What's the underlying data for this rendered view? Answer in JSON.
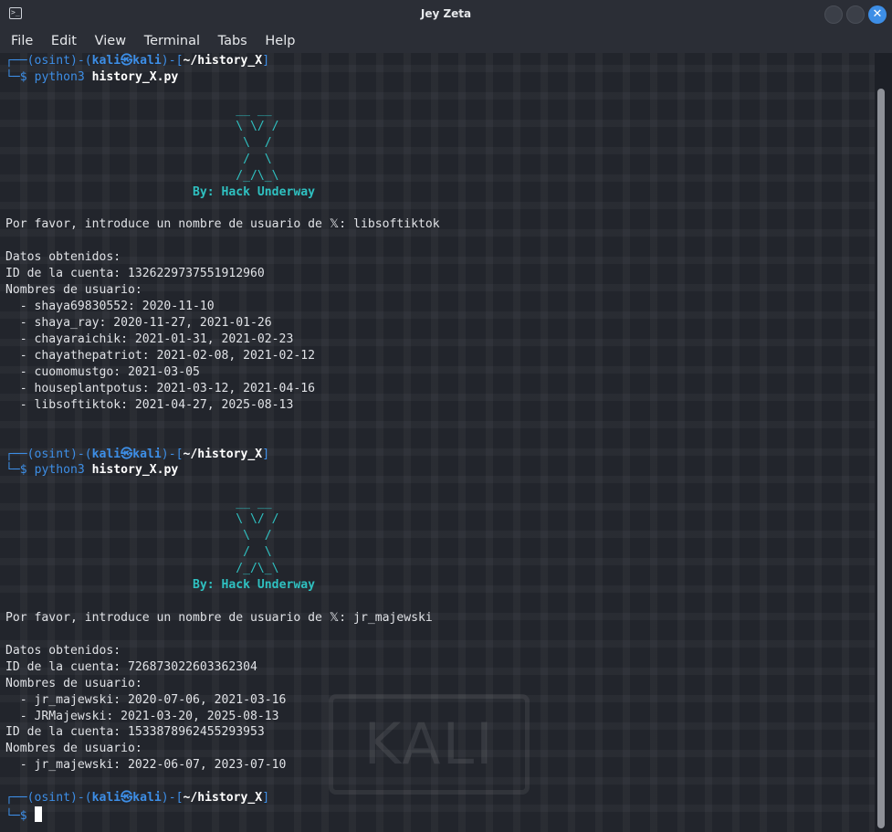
{
  "window": {
    "title": "Jey Zeta",
    "app_icon": "terminal-icon",
    "controls": [
      "minimize-icon",
      "maximize-icon",
      "close-icon"
    ],
    "close_glyph": "✕"
  },
  "menu": [
    "File",
    "Edit",
    "View",
    "Terminal",
    "Tabs",
    "Help"
  ],
  "prompt": {
    "corner_top": "┌──",
    "env": "(osint)",
    "dash": "-",
    "open": "(",
    "user": "kali㉿kali",
    "close": ")",
    "path_open": "-[",
    "path": "~/history_X",
    "path_close": "]",
    "corner_bottom": "└─",
    "symbol": "$ "
  },
  "command": {
    "name": "python3",
    "arg": "history_X.py"
  },
  "banner": {
    "art": [
      "__ __",
      "\\ \\/ /",
      " \\  /",
      " /  \\",
      "/_/\\_\\"
    ],
    "by": "By: Hack Underway"
  },
  "sessions": [
    {
      "question": "Por favor, introduce un nombre de usuario de 𝕏: libsoftiktok",
      "results_header": "Datos obtenidos:",
      "accounts": [
        {
          "id_line": "ID de la cuenta: 1326229737551912960",
          "names_header": "Nombres de usuario:",
          "names": [
            "  - shaya69830552: 2020-11-10",
            "  - shaya_ray: 2020-11-27, 2021-01-26",
            "  - chayaraichik: 2021-01-31, 2021-02-23",
            "  - chayathepatriot: 2021-02-08, 2021-02-12",
            "  - cuomomustgo: 2021-03-05",
            "  - houseplantpotus: 2021-03-12, 2021-04-16",
            "  - libsoftiktok: 2021-04-27, 2025-08-13"
          ]
        }
      ]
    },
    {
      "question": "Por favor, introduce un nombre de usuario de 𝕏: jr_majewski",
      "results_header": "Datos obtenidos:",
      "accounts": [
        {
          "id_line": "ID de la cuenta: 726873022603362304",
          "names_header": "Nombres de usuario:",
          "names": [
            "  - jr_majewski: 2020-07-06, 2021-03-16",
            "  - JRMajewski: 2021-03-20, 2025-08-13"
          ]
        },
        {
          "id_line": "ID de la cuenta: 1533878962455293953",
          "names_header": "Nombres de usuario:",
          "names": [
            "  - jr_majewski: 2022-06-07, 2023-07-10"
          ]
        }
      ]
    }
  ],
  "wallpaper_logo": "KALI",
  "colors": {
    "prompt_blue": "#3d8ee6",
    "banner_cyan": "#2fc1c1",
    "background": "#22252c"
  }
}
